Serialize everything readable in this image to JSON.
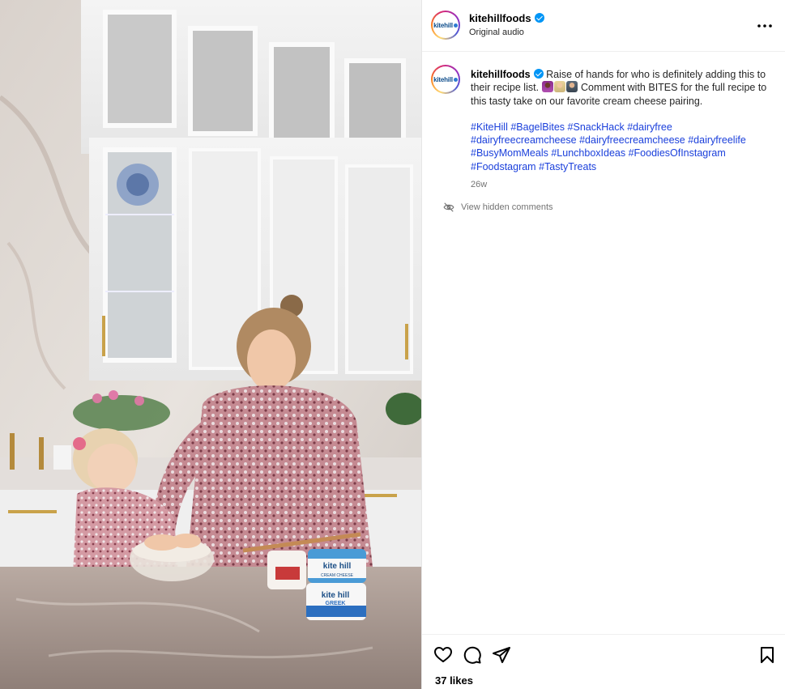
{
  "post": {
    "username": "kitehillfoods",
    "audio": "Original audio",
    "avatar_text": "kitehill",
    "caption_user": "kitehillfoods",
    "caption_part1": " Raise of hands for who is definitely adding this to their recipe list. ",
    "caption_part2": " Comment with BITES for the full recipe to this tasty take on our favorite cream cheese pairing.",
    "hashtags": [
      "#KiteHill",
      "#BagelBites",
      "#SnackHack",
      "#dairyfree",
      "#dairyfreecreamcheese",
      "#dairyfreecreamcheese",
      "#dairyfreelife",
      "#BusyMomMeals",
      "#LunchboxIdeas",
      "#FoodiesOfInstagram",
      "#Foodstagram",
      "#TastyTreats"
    ],
    "age": "26w",
    "hidden_comments": "View hidden comments",
    "likes": "37 likes"
  },
  "icons": {
    "more": "more-horizontal-icon",
    "verified": "verified-badge-icon",
    "hidden": "eye-off-icon",
    "like": "heart-icon",
    "comment": "comment-icon",
    "share": "paper-plane-icon",
    "save": "bookmark-icon"
  },
  "colors": {
    "link": "#1a3fdb",
    "verified": "#0095f6",
    "muted": "#737373"
  },
  "media": {
    "product_labels": [
      "kite hill",
      "CREAM CHEESE",
      "kite hill",
      "GREEK"
    ]
  }
}
